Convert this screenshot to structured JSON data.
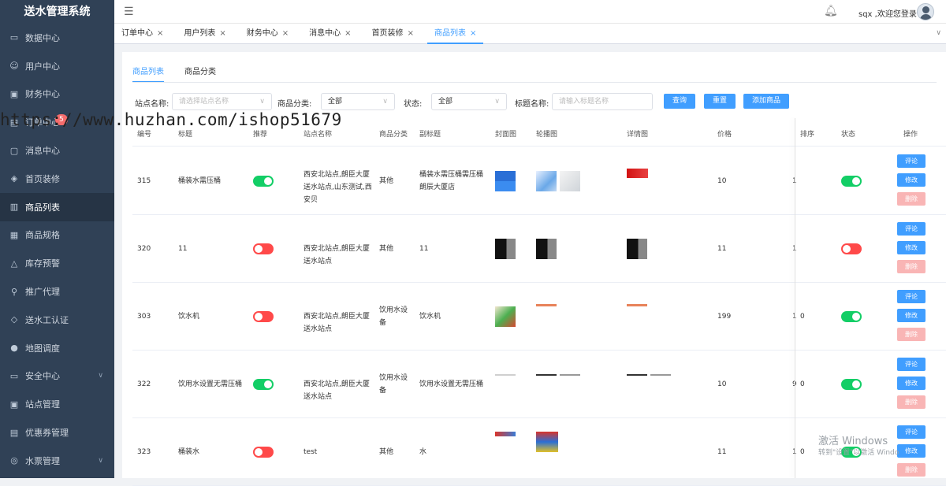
{
  "app_title": "送水管理系统",
  "sidebar": {
    "badge": "5",
    "items": [
      {
        "label": "数据中心",
        "icon": "dashboard-icon",
        "glyph": "▭"
      },
      {
        "label": "用户中心",
        "icon": "user-icon",
        "glyph": "☺"
      },
      {
        "label": "财务中心",
        "icon": "wallet-icon",
        "glyph": "▣"
      },
      {
        "label": "订单中心",
        "icon": "order-icon",
        "glyph": "▤"
      },
      {
        "label": "消息中心",
        "icon": "message-icon",
        "glyph": "▢"
      },
      {
        "label": "首页装修",
        "icon": "cube-icon",
        "glyph": "◈"
      },
      {
        "label": "商品列表",
        "icon": "clipboard-icon",
        "glyph": "▥"
      },
      {
        "label": "商品规格",
        "icon": "spec-icon",
        "glyph": "▦"
      },
      {
        "label": "库存预警",
        "icon": "bell-icon",
        "glyph": "△"
      },
      {
        "label": "推广代理",
        "icon": "share-icon",
        "glyph": "⚲"
      },
      {
        "label": "送水工认证",
        "icon": "box-icon",
        "glyph": "◇"
      },
      {
        "label": "地图调度",
        "icon": "location-icon",
        "glyph": "●"
      },
      {
        "label": "安全中心",
        "icon": "shield-icon",
        "glyph": "▭"
      },
      {
        "label": "站点管理",
        "icon": "station-icon",
        "glyph": "▣"
      },
      {
        "label": "优惠券管理",
        "icon": "coupon-icon",
        "glyph": "▤"
      },
      {
        "label": "水票管理",
        "icon": "ticket-icon",
        "glyph": "◎"
      }
    ]
  },
  "topbar": {
    "user_text": "sqx ,欢迎您登录"
  },
  "tabs": [
    {
      "label": "订单中心"
    },
    {
      "label": "用户列表"
    },
    {
      "label": "财务中心"
    },
    {
      "label": "消息中心"
    },
    {
      "label": "首页装修"
    },
    {
      "label": "商品列表"
    }
  ],
  "subtabs": [
    "商品列表",
    "商品分类"
  ],
  "filters": {
    "station_label": "站点名称:",
    "station_placeholder": "请选择站点名称",
    "category_label": "商品分类:",
    "category_value": "全部",
    "status_label": "状态:",
    "status_value": "全部",
    "title_label": "标题名称:",
    "title_placeholder": "请输入标题名称",
    "query_btn": "查询",
    "reset_btn": "重置",
    "add_btn": "添加商品"
  },
  "watermark": "https://www.huzhan.com/ishop51679",
  "table": {
    "headers": [
      "编号",
      "标题",
      "推荐",
      "站点名称",
      "商品分类",
      "副标题",
      "封面图",
      "轮播图",
      "详情图",
      "价格",
      "排序",
      "状态",
      "操作"
    ],
    "actions": {
      "comment": "评论",
      "edit": "修改",
      "delete": "删除"
    },
    "rows": [
      {
        "id": "315",
        "title": "桶装水需压桶",
        "recommend": true,
        "station": "西安北站点,朗臣大厦送水站点,山东测试,西安贝",
        "category": "其他",
        "subtitle": "桶装水需压桶需压桶朗辰大厦店",
        "price": "10",
        "sort_partial": "1",
        "sort": "",
        "status": true
      },
      {
        "id": "320",
        "title": "11",
        "recommend": false,
        "station": "西安北站点,朗臣大厦送水站点",
        "category": "其他",
        "subtitle": "11",
        "price": "11",
        "sort_partial": "1",
        "sort": "",
        "status": false
      },
      {
        "id": "303",
        "title": "饮水机",
        "recommend": false,
        "station": "西安北站点,朗臣大厦送水站点",
        "category": "饮用水设备",
        "subtitle": "饮水机",
        "price": "199",
        "sort_partial": "1",
        "sort": "0",
        "status": true
      },
      {
        "id": "322",
        "title": "饮用水设置无需压桶",
        "recommend": true,
        "station": "西安北站点,朗臣大厦送水站点",
        "category": "饮用水设备",
        "subtitle": "饮用水设置无需压桶",
        "price": "10",
        "sort_partial": "9",
        "sort": "0",
        "status": true
      },
      {
        "id": "323",
        "title": "桶装水",
        "recommend": false,
        "station": "test",
        "category": "其他",
        "subtitle": "水",
        "price": "11",
        "sort_partial": "1",
        "sort": "0",
        "status": true
      }
    ]
  },
  "windows_activation": {
    "line1": "激活 Windows",
    "line2": "转到\"设置\"以激活 Windo"
  }
}
